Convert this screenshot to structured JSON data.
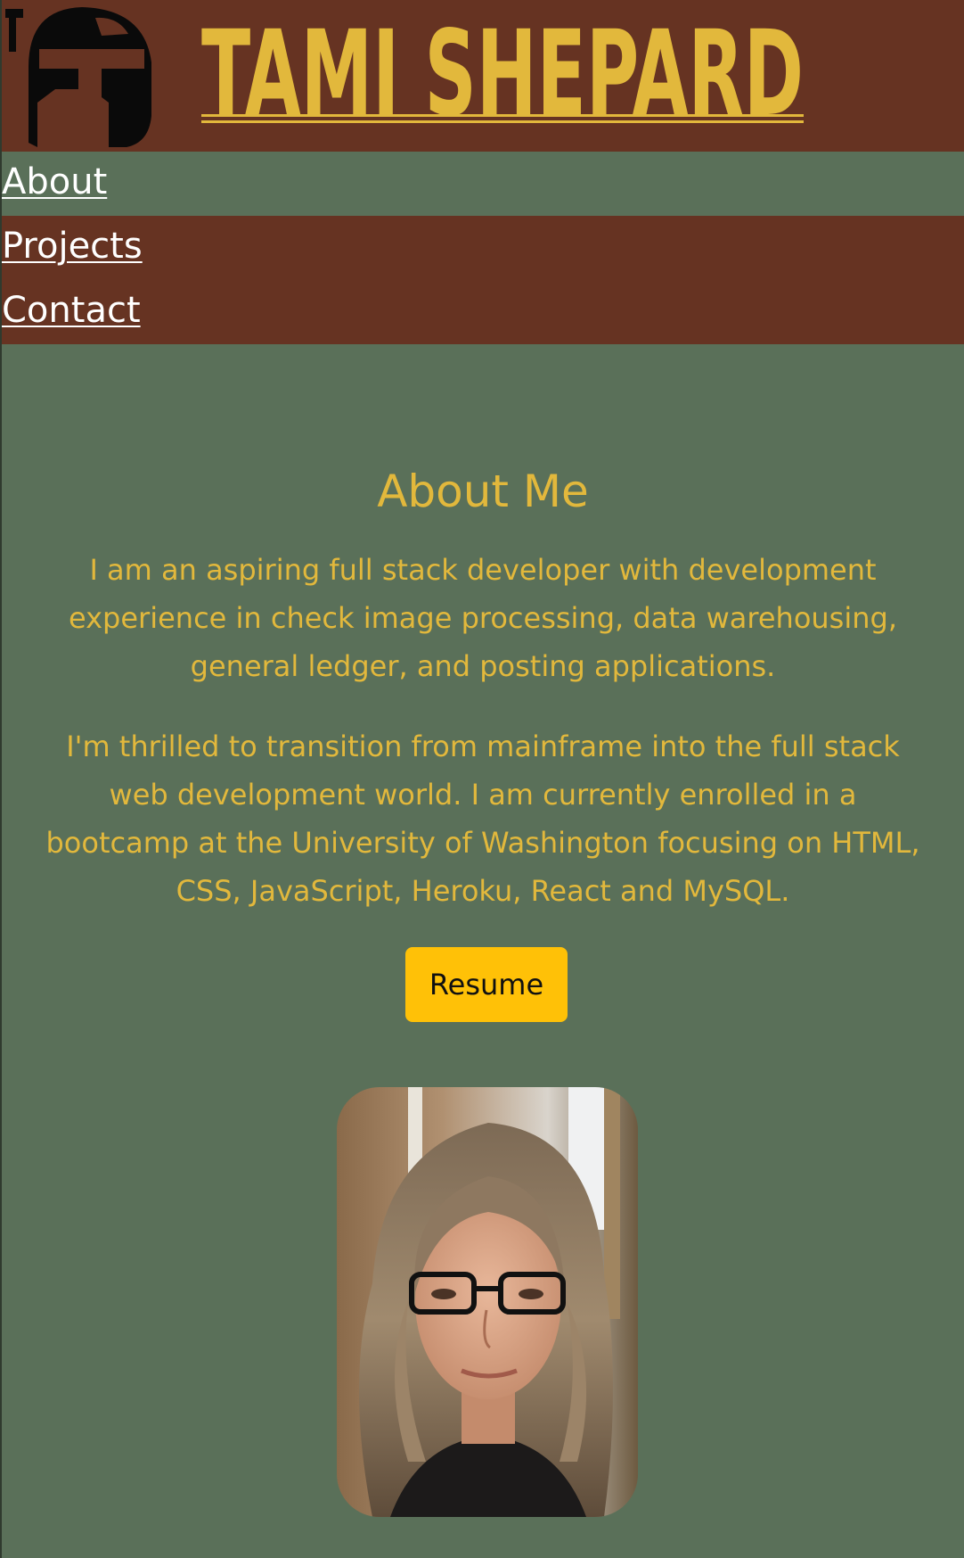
{
  "brand": {
    "name": "TAMI SHEPARD",
    "logo_icon": "helmet-icon",
    "colors": {
      "banner": "#663322",
      "gold": "#e2b83c",
      "background": "#5a7059"
    }
  },
  "nav": {
    "items": [
      {
        "label": "About"
      },
      {
        "label": "Projects"
      },
      {
        "label": "Contact"
      }
    ]
  },
  "about": {
    "title": "About Me",
    "paragraphs": [
      "I am an aspiring full stack developer with development experience in check image processing, data warehousing, general ledger, and posting applications.",
      "I'm thrilled to transition from mainframe into the full stack web development world. I am currently enrolled in a bootcamp at the University of Washington focusing on HTML, CSS, JavaScript, Heroku, React and MySQL."
    ],
    "resume_label": "Resume",
    "resume_color": "#ffc107",
    "portrait_icon": "portrait-photo"
  }
}
